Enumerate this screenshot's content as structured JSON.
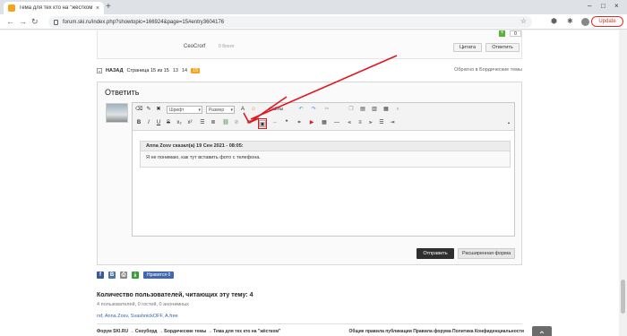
{
  "browser": {
    "tab_title": "Тема для тех кто на \"жёстком\"",
    "new_tab": "+",
    "url": "forum.ski.ru/index.php?showtopic=166924&page=15#entry3604176",
    "update_label": "Update"
  },
  "post": {
    "author": "CeoCrorf",
    "blogs": "0 блогя",
    "vote_plus": "+",
    "vote_count": "0",
    "quote_button": "Цитата",
    "reply_button": "Ответить"
  },
  "pagination": {
    "prev": "«",
    "back_label": "НАЗАД",
    "page_info": "Страница 15 из 15",
    "pages": [
      "13",
      "14"
    ],
    "current": "15",
    "back_to_section": "Обратно в Бордические темы"
  },
  "reply": {
    "title": "Ответить",
    "font_select": "Шрифт",
    "size_select": "Размер",
    "attach_label": "файлы",
    "quote_header": "Anna Zosv сказал(а) 19 Сен 2021 - 08:05:",
    "quote_body": "Я не понимаю, как тут вставить фото с телефона.",
    "send_button": "Отправить",
    "advanced_button": "Расширенная форма"
  },
  "social": {
    "like_label": "Нравится 0"
  },
  "users": {
    "title": "Количество пользователей, читающих эту тему: 4",
    "subtitle": "4 пользователей, 0 гостей, 0 анонимных",
    "list": "rsf, Anna Zosv, SvashnickOFF, A.free"
  },
  "footer": {
    "breadcrumb": "Форум SKI.RU → Сноуборд → Бордические темы → Тема для тех кто на \"жёстком\"",
    "links": "Общие правила публикации   Правила форума   Политика Конфиденциальности"
  },
  "colors": {
    "accent": "#f7a21b",
    "annotation": "#e0171f",
    "send": "#2f2f2f"
  }
}
